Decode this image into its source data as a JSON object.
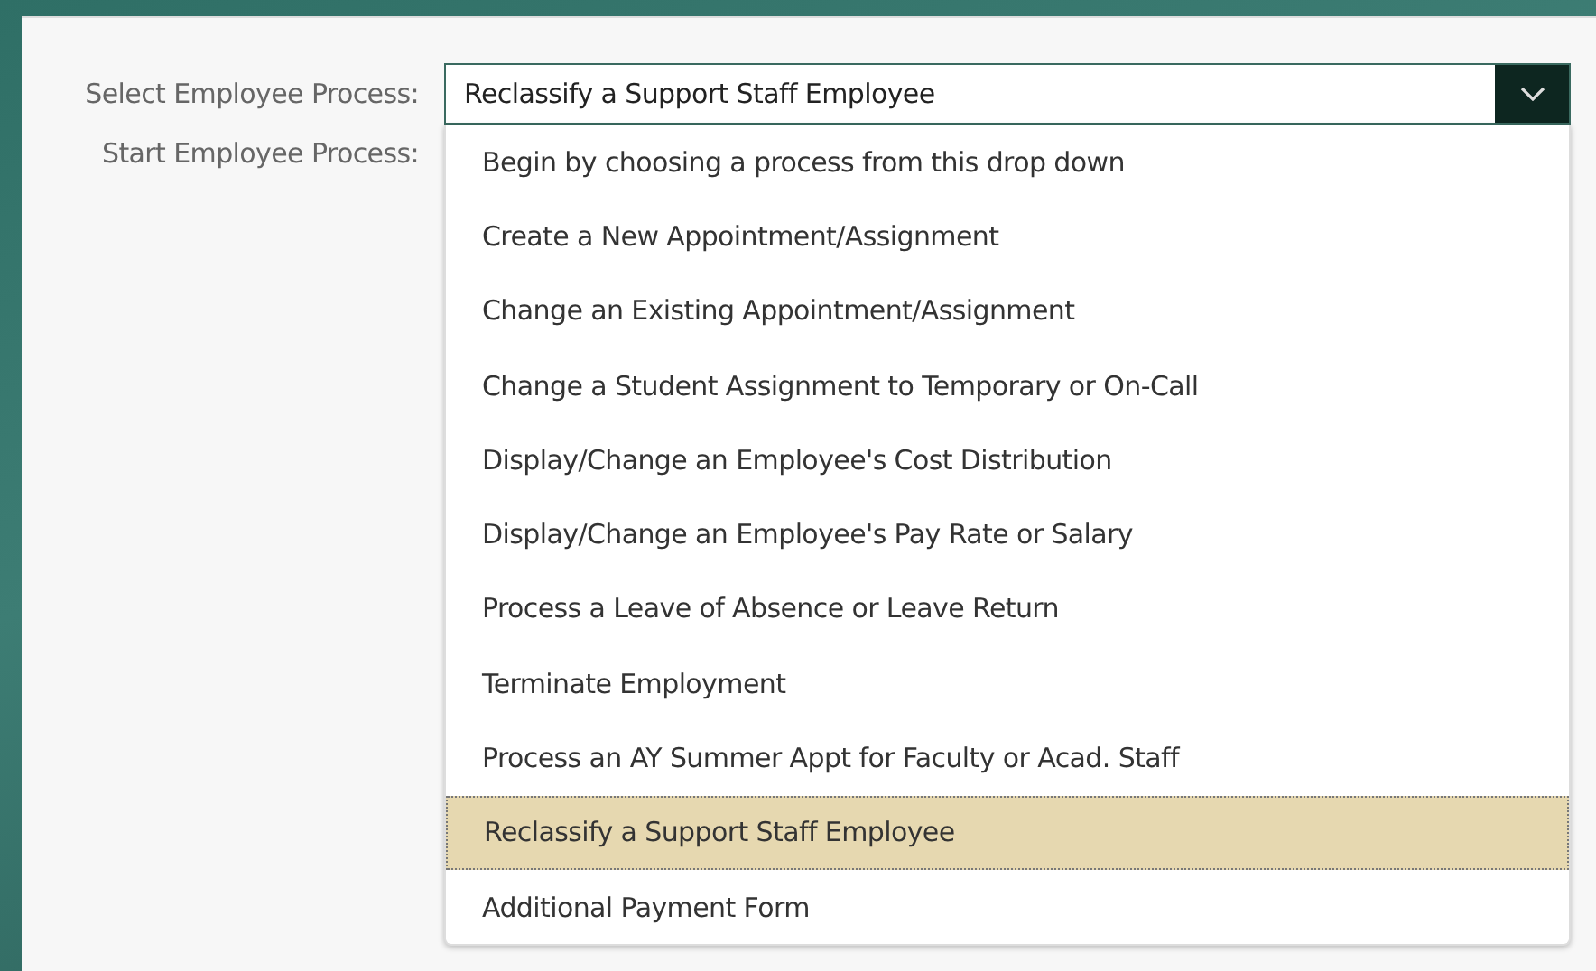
{
  "form": {
    "fields": [
      {
        "label": "Select Employee Process:",
        "value": "Reclassify a Support Staff Employee",
        "kind": "dropdown",
        "expanded": true,
        "options": [
          {
            "label": "Begin by choosing a process from this drop down",
            "selected": false
          },
          {
            "label": "Create a New Appointment/Assignment",
            "selected": false
          },
          {
            "label": "Change an Existing Appointment/Assignment",
            "selected": false
          },
          {
            "label": "Change a Student Assignment to Temporary or On-Call",
            "selected": false
          },
          {
            "label": "Display/Change an Employee's Cost Distribution",
            "selected": false
          },
          {
            "label": "Display/Change an Employee's Pay Rate or Salary",
            "selected": false
          },
          {
            "label": "Process a Leave of Absence or Leave Return",
            "selected": false
          },
          {
            "label": "Terminate Employment",
            "selected": false
          },
          {
            "label": "Process an AY Summer Appt for Faculty or Acad. Staff",
            "selected": false
          },
          {
            "label": "Reclassify a Support Staff Employee",
            "selected": true
          },
          {
            "label": "Additional Payment Form",
            "selected": false
          }
        ]
      },
      {
        "label": "Start Employee Process:",
        "kind": "none"
      }
    ]
  }
}
